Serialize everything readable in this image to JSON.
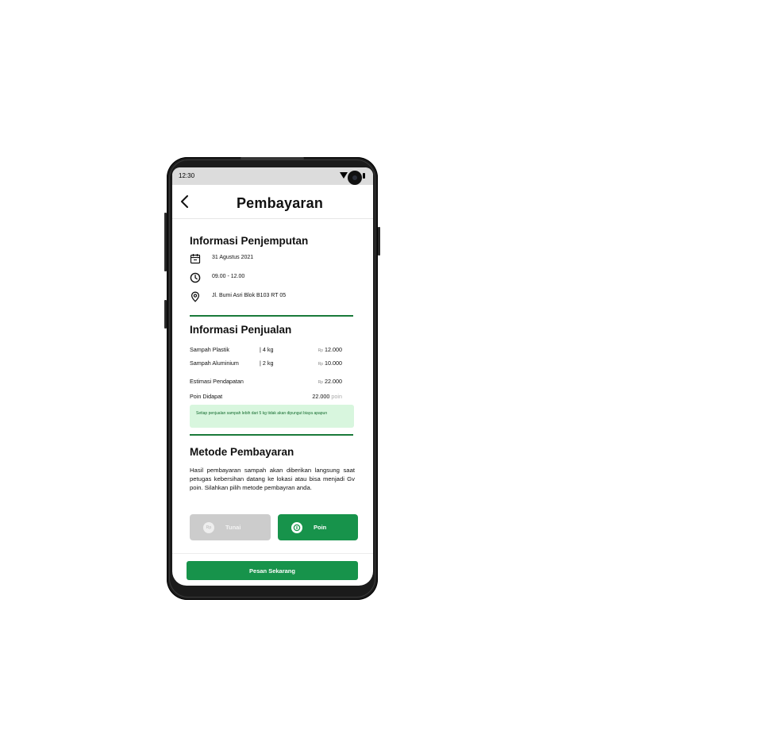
{
  "status_bar": {
    "time": "12:30"
  },
  "header": {
    "title": "Pembayaran"
  },
  "pickup": {
    "title": "Informasi Penjemputan",
    "date": "31 Agustus 2021",
    "time_range": "09.00 - 12.00",
    "address": "Jl. Bumi Asri Blok B103 RT 05"
  },
  "sales": {
    "title": "Informasi Penjualan",
    "items": [
      {
        "name": "Sampah Plastik",
        "qty": "|  4 kg",
        "currency": "Rp",
        "price": "12.000"
      },
      {
        "name": "Sampah Aluminium",
        "qty": "|  2 kg",
        "currency": "Rp",
        "price": "10.000"
      }
    ],
    "estimate_label": "Estimasi Pendapatan",
    "estimate_currency": "Rp",
    "estimate_value": "22.000",
    "points_label": "Poin Didapat",
    "points_value": "22.000",
    "points_unit": "poin",
    "notice": "Setiap penjualan sampah lebih dari 5 kg tidak akan dipungut biaya apapun"
  },
  "payment": {
    "title": "Metode Pembayaran",
    "description": "Hasil pembayaran sampah akan diberikan langsung saat petugas kebersihan datang ke lokasi atau bisa menjadi Gv poin. Silahkan pilih metode pembayran anda.",
    "tunai_icon": "Rp",
    "tunai_label": "Tunai",
    "poin_label": "Poin",
    "selected": "Poin"
  },
  "footer": {
    "order_label": "Pesan Sekarang"
  },
  "colors": {
    "accent": "#17934b",
    "divider": "#1a7a3a",
    "notice_bg": "#d8f6de",
    "disabled": "#cccccc"
  }
}
